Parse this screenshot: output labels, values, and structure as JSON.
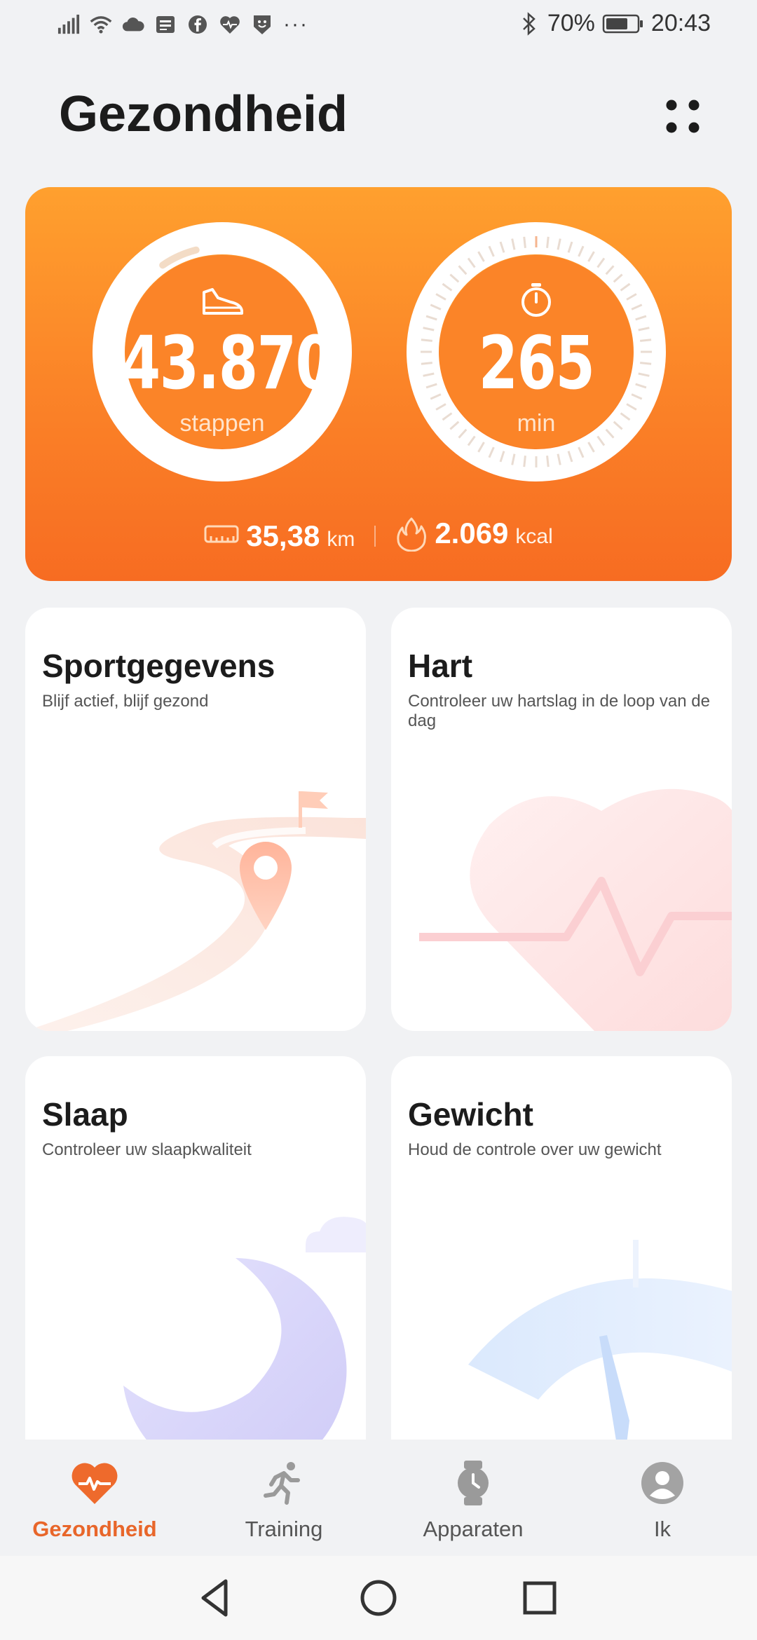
{
  "status_bar": {
    "battery_percent": "70%",
    "time": "20:43",
    "more_indicator": "···",
    "left_icons": [
      "signal-icon",
      "wifi-icon",
      "cloud-icon",
      "news-icon",
      "facebook-icon",
      "heart-rate-icon",
      "shield-face-icon"
    ],
    "right_icons": [
      "bluetooth-icon",
      "battery-icon"
    ]
  },
  "header": {
    "title": "Gezondheid"
  },
  "hero": {
    "steps_value": "43.870",
    "steps_unit": "stappen",
    "steps_progress": 0.96,
    "time_value": "265",
    "time_unit": "min",
    "distance_value": "35,38",
    "distance_unit": "km",
    "calories_value": "2.069",
    "calories_unit": "kcal"
  },
  "tiles": [
    {
      "title": "Sportgegevens",
      "subtitle": "Blijf actief, blijf gezond"
    },
    {
      "title": "Hart",
      "subtitle": "Controleer uw hartslag in de loop van de dag"
    },
    {
      "title": "Slaap",
      "subtitle": "Controleer uw slaapkwaliteit"
    },
    {
      "title": "Gewicht",
      "subtitle": "Houd de controle over uw gewicht"
    }
  ],
  "bottom_nav": [
    {
      "label": "Gezondheid",
      "icon": "heart-pulse-icon",
      "active": true
    },
    {
      "label": "Training",
      "icon": "runner-icon",
      "active": false
    },
    {
      "label": "Apparaten",
      "icon": "watch-icon",
      "active": false
    },
    {
      "label": "Ik",
      "icon": "profile-icon",
      "active": false
    }
  ],
  "colors": {
    "accent": "#e8662a",
    "hero_top": "#ffa02e",
    "hero_bottom": "#f76c22",
    "background": "#f1f2f4"
  }
}
